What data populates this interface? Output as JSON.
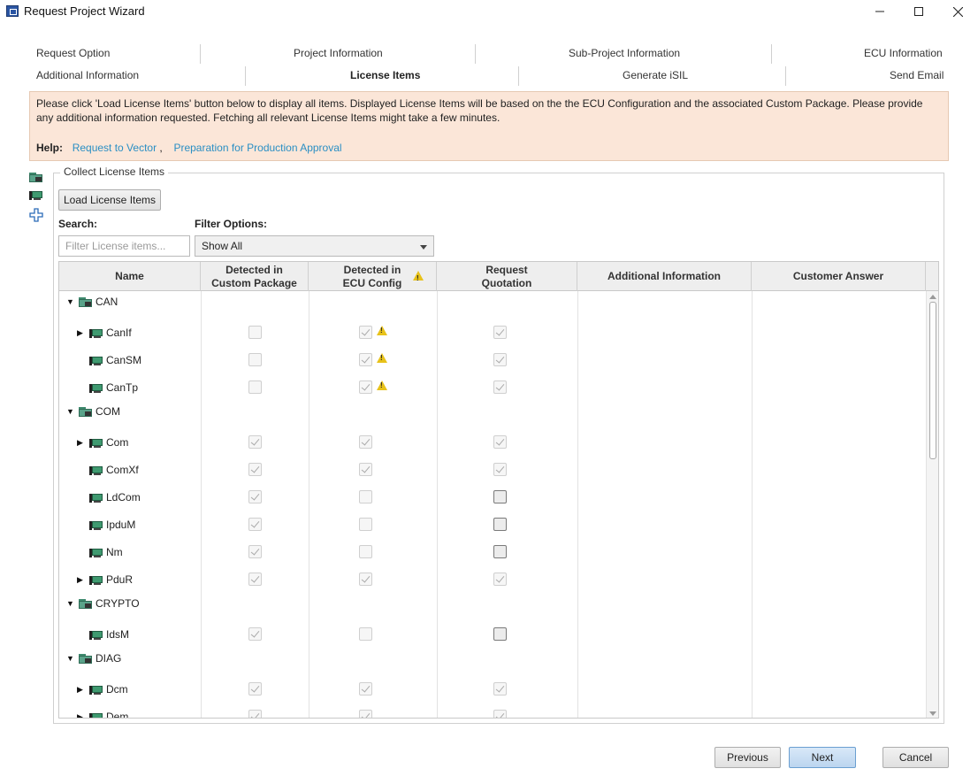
{
  "window": {
    "title": "Request Project Wizard",
    "controls": {
      "minimize": "—",
      "maximize": "☐",
      "close": "✕"
    }
  },
  "steps": {
    "row1": [
      "Request Option",
      "Project Information",
      "Sub-Project Information",
      "ECU Information"
    ],
    "row2": [
      "Additional Information",
      "License Items",
      "Generate iSIL",
      "Send Email"
    ],
    "active": "License Items"
  },
  "banner": {
    "text": "Please click 'Load License Items' button below to display all items. Displayed License Items will be based on the the ECU Configuration and the associated Custom Package. Please provide any additional information requested. Fetching all relevant License Items might take a few minutes.",
    "help_label": "Help:",
    "links": [
      "Request to Vector",
      "Preparation for Production Approval"
    ],
    "link_separator": ","
  },
  "group": {
    "title": "Collect License Items",
    "load_button": "Load License Items",
    "search_label": "Search:",
    "search_placeholder": "Filter License items...",
    "filter_label": "Filter Options:",
    "filter_value": "Show All"
  },
  "table": {
    "headers": {
      "name": "Name",
      "custom_package": "Detected in\nCustom Package",
      "ecu_config": "Detected in\nECU Config",
      "request_quotation": "Request\nQuotation",
      "additional_info": "Additional Information",
      "customer_answer": "Customer Answer"
    },
    "rows": [
      {
        "label": "CAN",
        "kind": "folder",
        "level": 0,
        "expander": "down"
      },
      {
        "label": "CanIf",
        "kind": "module",
        "level": 1,
        "expander": "right",
        "custom_package": false,
        "ecu_config": true,
        "ecu_warning": true,
        "quotation": true,
        "quotation_enabled": false
      },
      {
        "label": "CanSM",
        "kind": "module",
        "level": 1,
        "expander": "",
        "custom_package": false,
        "ecu_config": true,
        "ecu_warning": true,
        "quotation": true,
        "quotation_enabled": false
      },
      {
        "label": "CanTp",
        "kind": "module",
        "level": 1,
        "expander": "",
        "custom_package": false,
        "ecu_config": true,
        "ecu_warning": true,
        "quotation": true,
        "quotation_enabled": false
      },
      {
        "label": "COM",
        "kind": "folder",
        "level": 0,
        "expander": "down"
      },
      {
        "label": "Com",
        "kind": "module",
        "level": 1,
        "expander": "right",
        "custom_package": true,
        "ecu_config": true,
        "ecu_warning": false,
        "quotation": true,
        "quotation_enabled": false
      },
      {
        "label": "ComXf",
        "kind": "module",
        "level": 1,
        "expander": "",
        "custom_package": true,
        "ecu_config": true,
        "ecu_warning": false,
        "quotation": true,
        "quotation_enabled": false
      },
      {
        "label": "LdCom",
        "kind": "module",
        "level": 1,
        "expander": "",
        "custom_package": true,
        "ecu_config": false,
        "ecu_warning": false,
        "quotation": false,
        "quotation_enabled": true
      },
      {
        "label": "IpduM",
        "kind": "module",
        "level": 1,
        "expander": "",
        "custom_package": true,
        "ecu_config": false,
        "ecu_warning": false,
        "quotation": false,
        "quotation_enabled": true
      },
      {
        "label": "Nm",
        "kind": "module",
        "level": 1,
        "expander": "",
        "custom_package": true,
        "ecu_config": false,
        "ecu_warning": false,
        "quotation": false,
        "quotation_enabled": true
      },
      {
        "label": "PduR",
        "kind": "module",
        "level": 1,
        "expander": "right",
        "custom_package": true,
        "ecu_config": true,
        "ecu_warning": false,
        "quotation": true,
        "quotation_enabled": false
      },
      {
        "label": "CRYPTO",
        "kind": "folder",
        "level": 0,
        "expander": "down"
      },
      {
        "label": "IdsM",
        "kind": "module",
        "level": 1,
        "expander": "",
        "custom_package": true,
        "ecu_config": false,
        "ecu_warning": false,
        "quotation": false,
        "quotation_enabled": true
      },
      {
        "label": "DIAG",
        "kind": "folder",
        "level": 0,
        "expander": "down"
      },
      {
        "label": "Dcm",
        "kind": "module",
        "level": 1,
        "expander": "right",
        "custom_package": true,
        "ecu_config": true,
        "ecu_warning": false,
        "quotation": true,
        "quotation_enabled": false
      },
      {
        "label": "Dem",
        "kind": "module",
        "level": 1,
        "expander": "right",
        "custom_package": true,
        "ecu_config": true,
        "ecu_warning": false,
        "quotation": true,
        "quotation_enabled": false
      }
    ]
  },
  "footer": {
    "previous": "Previous",
    "next": "Next",
    "cancel": "Cancel"
  },
  "icons": {
    "side": [
      "folder-package-icon",
      "module-icon",
      "add-icon"
    ],
    "tree_expand": "▶",
    "tree_collapse": "▼"
  },
  "colors": {
    "banner_bg": "#fbe6d8",
    "link": "#2a8fc4",
    "warning": "#e8c21a",
    "next_button": "#bcd5ef"
  }
}
